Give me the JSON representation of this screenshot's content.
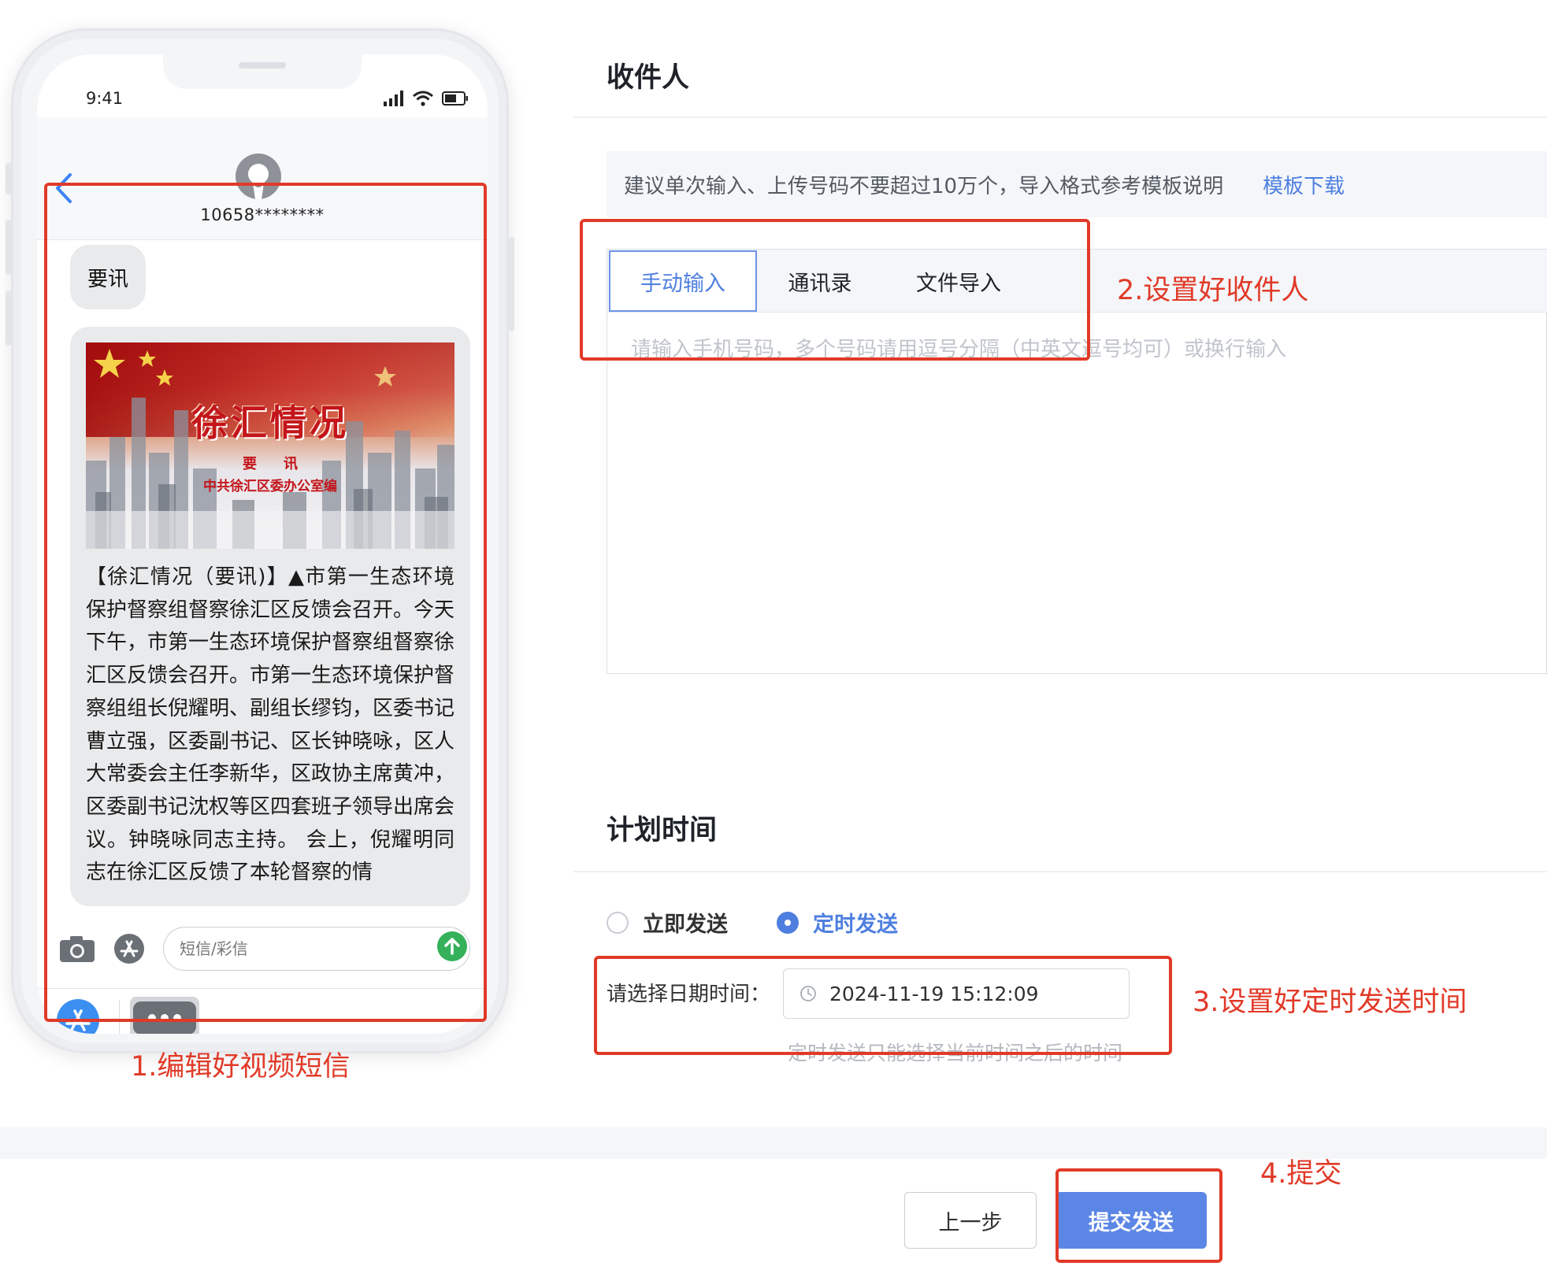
{
  "phone": {
    "status_time": "9:41",
    "sender": "10658********",
    "short_message": "要讯",
    "image_title": "徐汇情况",
    "image_subtitle": "要讯",
    "image_caption": "中共徐汇区委办公室编",
    "message_text": "【徐汇情况（要讯)】▲市第一生态环境保护督察组督察徐汇区反馈会召开。今天下午，市第一生态环境保护督察组督察徐汇区反馈会召开。市第一生态环境保护督察组组长倪耀明、副组长缪钧，区委书记曹立强，区委副书记、区长钟晓咏，区人大常委会主任李新华，区政协主席黄冲，区委副书记沈权等区四套班子领导出席会议。钟晓咏同志主持。 会上，倪耀明同志在徐汇区反馈了本轮督察的情",
    "input_placeholder": "短信/彩信"
  },
  "annotations": {
    "step1": "1.编辑好视频短信",
    "step2": "2.设置好收件人",
    "step3": "3.设置好定时发送时间",
    "step4": "4.提交"
  },
  "recipients": {
    "title": "收件人",
    "tip": "建议单次输入、上传号码不要超过10万个，导入格式参考模板说明",
    "template_link": "模板下载",
    "tabs": [
      "手动输入",
      "通讯录",
      "文件导入"
    ],
    "active_tab": "手动输入",
    "textarea_placeholder": "请输入手机号码，多个号码请用逗号分隔（中英文逗号均可）或换行输入"
  },
  "schedule": {
    "title": "计划时间",
    "options": [
      "立即发送",
      "定时发送"
    ],
    "selected": "定时发送",
    "datetime_label": "请选择日期时间：",
    "datetime_value": "2024-11-19 15:12:09",
    "datetime_hint": "定时发送只能选择当前时间之后的时间"
  },
  "buttons": {
    "prev": "上一步",
    "submit": "提交发送"
  },
  "colors": {
    "accent": "#4e7fe0",
    "submit_bg": "#5b86e5",
    "annotation": "#e13a28"
  }
}
